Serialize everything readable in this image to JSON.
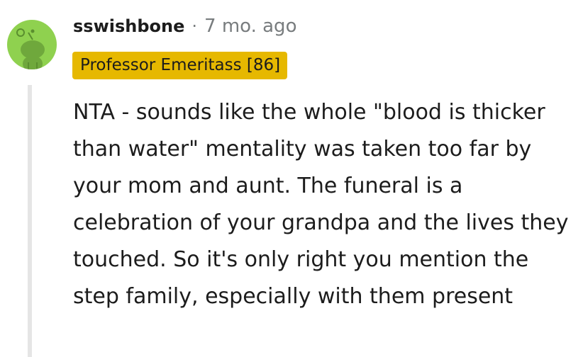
{
  "comment": {
    "username": "sswishbone",
    "separator": "·",
    "timestamp": "7 mo. ago",
    "flair": "Professor Emeritass [86]",
    "body": "NTA - sounds like the whole \"blood is thicker than water\" mentality was taken too far by your mom and aunt. The funeral is a celebration of your grandpa and the lives they touched. So it's only right you mention the step family, especially with them present"
  },
  "avatar": {
    "icon": "snoo-avatar-icon",
    "background_color": "#8fd14f"
  },
  "colors": {
    "flair_background": "#e6b800",
    "text": "#1c1c1c",
    "meta": "#787c7e",
    "thread_line": "#e5e5e5"
  }
}
